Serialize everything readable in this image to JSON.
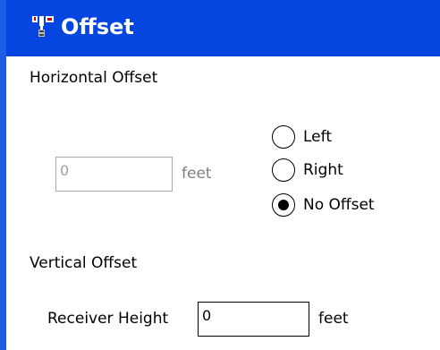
{
  "titlebar": {
    "title": "Offset",
    "icon": "app-device-icon"
  },
  "horizontal": {
    "section_label": "Horizontal Offset",
    "offset_value": "0",
    "unit": "feet",
    "enabled": false,
    "options": [
      {
        "label": "Left",
        "selected": false
      },
      {
        "label": "Right",
        "selected": false
      },
      {
        "label": "No Offset",
        "selected": true
      }
    ]
  },
  "vertical": {
    "section_label": "Vertical Offset",
    "receiver_label": "Receiver Height",
    "receiver_value": "0",
    "unit": "feet"
  },
  "colors": {
    "titlebar": "#0545e0",
    "title_text": "#ffffff",
    "disabled_text": "#808080"
  }
}
